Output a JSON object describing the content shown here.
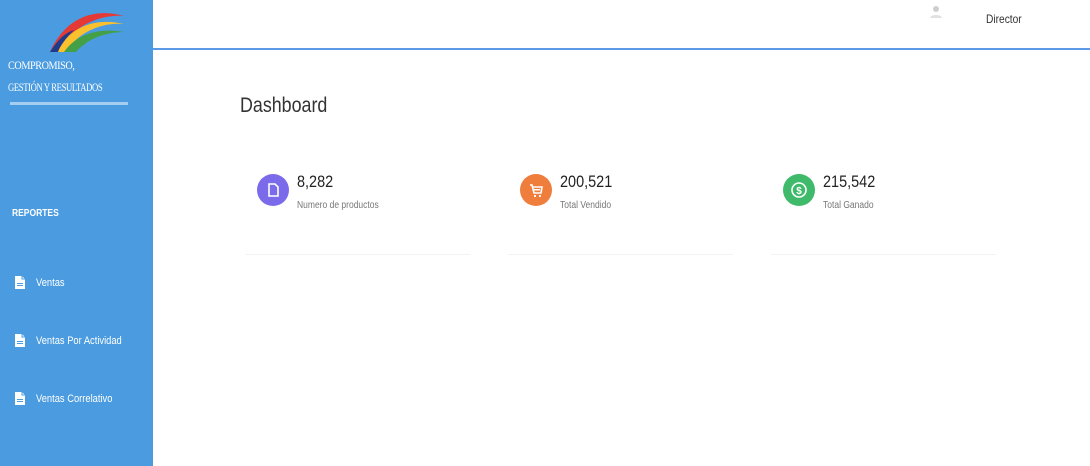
{
  "sidebar": {
    "logo": {
      "line1": "COMPROMISO,",
      "line2": "GESTIÓN Y RESULTADOS"
    },
    "section_title": "REPORTES",
    "items": [
      {
        "label": "Ventas",
        "icon": "document-icon"
      },
      {
        "label": "Ventas Por Actividad",
        "icon": "document-icon"
      },
      {
        "label": "Ventas Correlativo",
        "icon": "document-icon"
      }
    ]
  },
  "header": {
    "avatar_icon": "user-avatar-icon",
    "role": "Director"
  },
  "main": {
    "title": "Dashboard",
    "cards": [
      {
        "value": "8,282",
        "caption": "Numero de productos",
        "icon": "document-icon",
        "color": "#7b6bea"
      },
      {
        "value": "200,521",
        "caption": "Total Vendido",
        "icon": "cart-icon",
        "color": "#ef7d3c"
      },
      {
        "value": "215,542",
        "caption": "Total Ganado",
        "icon": "dollar-icon",
        "color": "#3fba6a"
      }
    ]
  },
  "colors": {
    "sidebar": "#4a9be0",
    "header_border": "#5b9ae6"
  }
}
